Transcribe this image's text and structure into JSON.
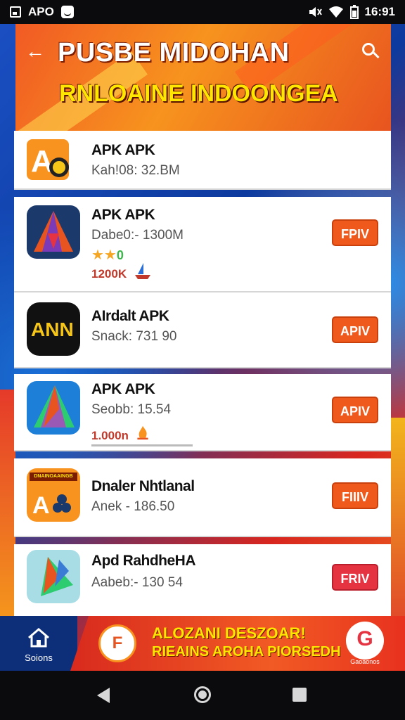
{
  "status_bar": {
    "left_label": "APO",
    "time": "16:91",
    "icons": [
      "notification-square-icon",
      "face-icon",
      "mute-icon",
      "wifi-icon",
      "battery-icon"
    ]
  },
  "header": {
    "title": "PUSBE MIDOHAN",
    "subtitle": "RNLOAINE INDOONGEA",
    "back_icon": "back-arrow-icon",
    "search_icon": "search-icon"
  },
  "apps": [
    {
      "name": "APK APK",
      "meta": "Kah!08: 32.BM",
      "button": "",
      "count": ""
    },
    {
      "name": "APK APK",
      "meta": "Dabe0:- 1300M",
      "stars": "★★",
      "rating_extra": "0",
      "count": "1200K",
      "button": "FPIV"
    },
    {
      "name": "AIrdalt APK",
      "meta": "Snack: 731 90",
      "count": "",
      "button": "APIV"
    },
    {
      "name": "APK APK",
      "meta": "Seobb: 15.54",
      "count": "1.000n",
      "button": "APIV"
    },
    {
      "name": "Dnaler Nhtlanal",
      "meta": "Anek - 186.50",
      "count": "",
      "button": "FIIIV",
      "icon_banner": "DNAINOAAINGB"
    },
    {
      "name": "Apd RahdheHA",
      "meta": "Aabeb:- 130 54",
      "count": "",
      "button": "FRIV"
    }
  ],
  "bottom_nav": {
    "home_label": "Soions"
  },
  "ad": {
    "line1": "ALOZANI DESZOAR!",
    "line2": "RIEAINS AROHA PIORSEDH",
    "logo_letter": "F",
    "g_letter": "G",
    "g_label": "Gaoaonos"
  },
  "colors": {
    "accent_orange": "#ef5a1c",
    "accent_red": "#e63342",
    "banner_yellow": "#ffe600"
  }
}
